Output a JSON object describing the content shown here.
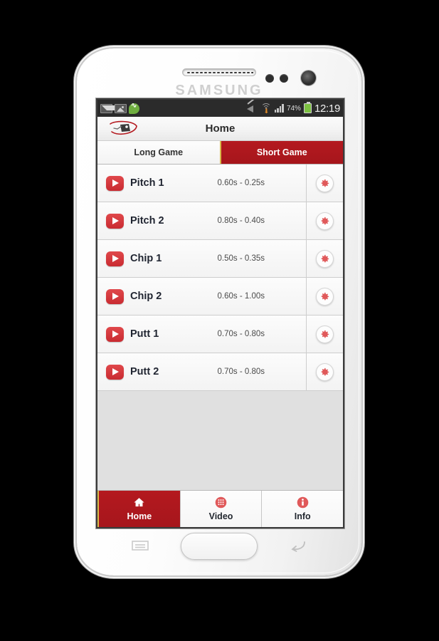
{
  "device": {
    "brand": "SAMSUNG",
    "earpiece_icon": "speaker-grille",
    "camera_icon": "front-camera",
    "home_button_label": "home-button",
    "menu_key_icon": "menu-icon",
    "back_key_icon": "back-icon"
  },
  "statusbar": {
    "left_icons": [
      "mail-icon",
      "gallery-icon",
      "chat-icon"
    ],
    "mute_icon": "mute-icon",
    "wifi_icon": "wifi-icon",
    "signal_icon": "signal-bars-icon",
    "battery_percent": "74%",
    "battery_icon": "battery-icon",
    "clock": "12:19"
  },
  "header": {
    "logo_icon": "golf-swing-logo",
    "title": "Home"
  },
  "tabs": [
    {
      "label": "Long Game",
      "active": false
    },
    {
      "label": "Short Game",
      "active": true
    }
  ],
  "list": {
    "rows": [
      {
        "play_icon": "play-icon",
        "label": "Pitch 1",
        "timing": "0.60s - 0.25s",
        "settings_icon": "gear-icon"
      },
      {
        "play_icon": "play-icon",
        "label": "Pitch 2",
        "timing": "0.80s - 0.40s",
        "settings_icon": "gear-icon"
      },
      {
        "play_icon": "play-icon",
        "label": "Chip 1",
        "timing": "0.50s - 0.35s",
        "settings_icon": "gear-icon"
      },
      {
        "play_icon": "play-icon",
        "label": "Chip 2",
        "timing": "0.60s - 1.00s",
        "settings_icon": "gear-icon"
      },
      {
        "play_icon": "play-icon",
        "label": "Putt 1",
        "timing": "0.70s - 0.80s",
        "settings_icon": "gear-icon"
      },
      {
        "play_icon": "play-icon",
        "label": "Putt 2",
        "timing": "0.70s - 0.80s",
        "settings_icon": "gear-icon"
      }
    ]
  },
  "bottom_nav": [
    {
      "label": "Home",
      "icon": "house-icon",
      "active": true
    },
    {
      "label": "Video",
      "icon": "grid-icon",
      "active": false
    },
    {
      "label": "Info",
      "icon": "info-icon",
      "active": false
    }
  ],
  "colors": {
    "brand_red": "#b4191f",
    "accent_red": "#d9534f",
    "divider_gold": "#d8b94a",
    "screen_bg": "#e0e0e0",
    "battery_green": "#7dc242"
  }
}
